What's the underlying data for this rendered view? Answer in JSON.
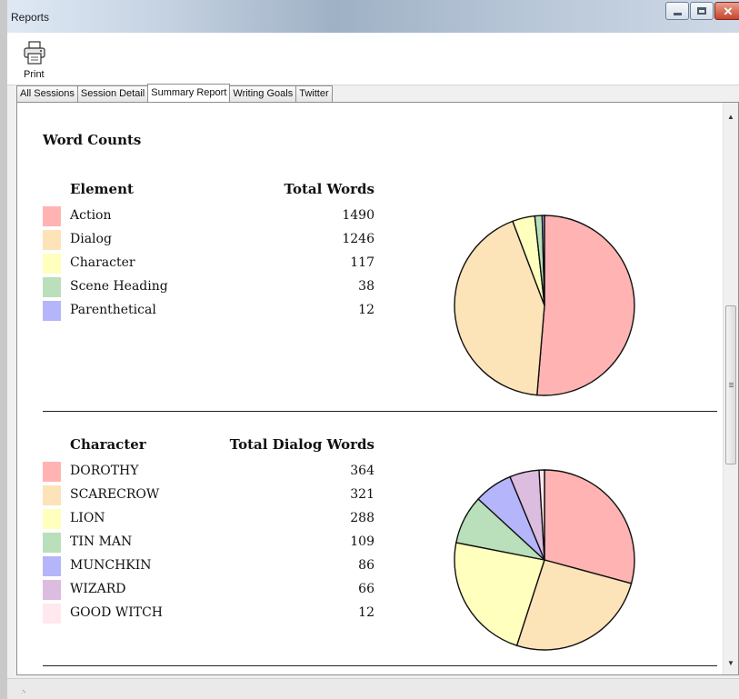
{
  "window": {
    "title": "Reports",
    "controls": {
      "minimize": "minimize-icon",
      "maximize": "maximize-icon",
      "close": "close-icon"
    }
  },
  "toolbar": {
    "print_label": "Print",
    "print_icon": "printer-icon"
  },
  "tabs": [
    {
      "label": "All Sessions",
      "active": false
    },
    {
      "label": "Session Detail",
      "active": false
    },
    {
      "label": "Summary Report",
      "active": true
    },
    {
      "label": "Writing Goals",
      "active": false
    },
    {
      "label": "Twitter",
      "active": false
    }
  ],
  "report": {
    "title": "Word Counts",
    "sections": [
      {
        "key": "elements",
        "col_label": "Element",
        "col_value": "Total Words",
        "rows": [
          {
            "label": "Action",
            "value": "1490",
            "color": "#ffb3b3"
          },
          {
            "label": "Dialog",
            "value": "1246",
            "color": "#fde3b8"
          },
          {
            "label": "Character",
            "value": "117",
            "color": "#ffffbe"
          },
          {
            "label": "Scene Heading",
            "value": "38",
            "color": "#b9dfbb"
          },
          {
            "label": "Parenthetical",
            "value": "12",
            "color": "#b5b5fb"
          }
        ]
      },
      {
        "key": "characters",
        "col_label": "Character",
        "col_value": "Total Dialog Words",
        "rows": [
          {
            "label": "DOROTHY",
            "value": "364",
            "color": "#ffb3b3"
          },
          {
            "label": "SCARECROW",
            "value": "321",
            "color": "#fde3b8"
          },
          {
            "label": "LION",
            "value": "288",
            "color": "#ffffbe"
          },
          {
            "label": "TIN MAN",
            "value": "109",
            "color": "#b9dfbb"
          },
          {
            "label": "MUNCHKIN",
            "value": "86",
            "color": "#b5b5fb"
          },
          {
            "label": "WIZARD",
            "value": "66",
            "color": "#dcbcdf"
          },
          {
            "label": "GOOD WITCH",
            "value": "12",
            "color": "#ffe9ee"
          }
        ]
      }
    ]
  },
  "chart_data": [
    {
      "type": "pie",
      "categories": [
        "Action",
        "Dialog",
        "Character",
        "Scene Heading",
        "Parenthetical"
      ],
      "values": [
        1490,
        1246,
        117,
        38,
        12
      ],
      "colors": [
        "#ffb3b3",
        "#fde3b8",
        "#ffffbe",
        "#b9dfbb",
        "#b5b5fb"
      ]
    },
    {
      "type": "pie",
      "categories": [
        "DOROTHY",
        "SCARECROW",
        "LION",
        "TIN MAN",
        "MUNCHKIN",
        "WIZARD",
        "GOOD WITCH"
      ],
      "values": [
        364,
        321,
        288,
        109,
        86,
        66,
        12
      ],
      "colors": [
        "#ffb3b3",
        "#fde3b8",
        "#ffffbe",
        "#b9dfbb",
        "#b5b5fb",
        "#dcbcdf",
        "#ffe9ee"
      ]
    }
  ]
}
